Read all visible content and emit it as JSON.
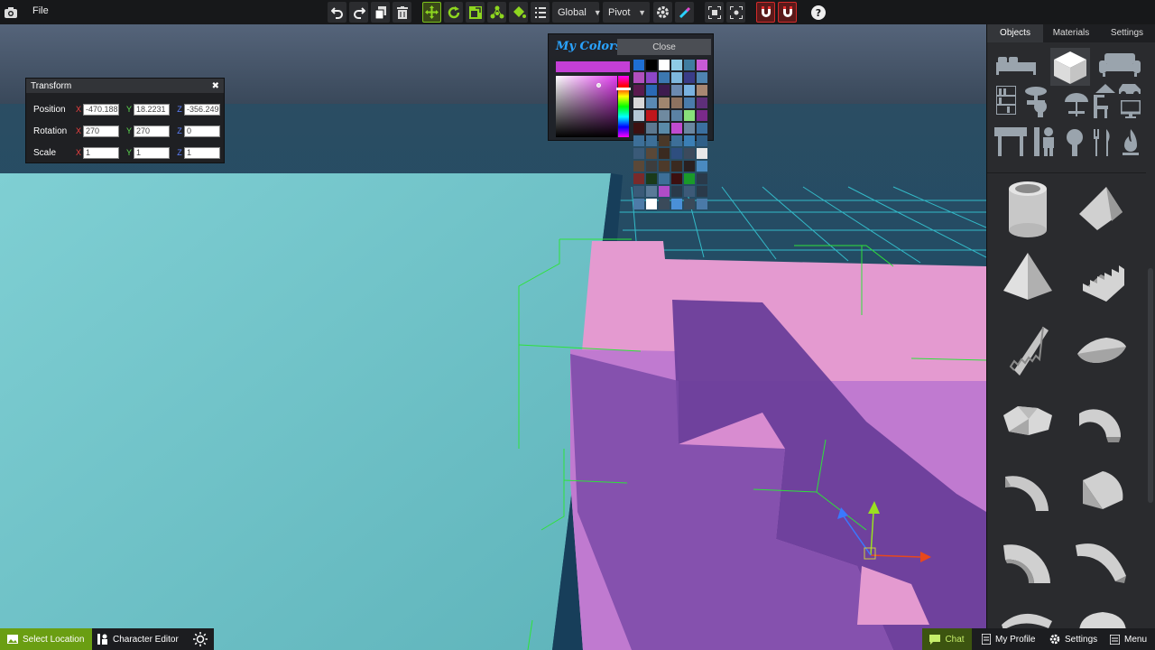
{
  "topbar": {
    "file_label": "File",
    "global_label": "Global",
    "pivot_label": "Pivot"
  },
  "transform": {
    "title": "Transform",
    "close_glyph": "✖",
    "rows": [
      {
        "label": "Position",
        "x": "-470.188",
        "y": "18.2231",
        "z": "-356.249"
      },
      {
        "label": "Rotation",
        "x": "270",
        "y": "270",
        "z": "0"
      },
      {
        "label": "Scale",
        "x": "1",
        "y": "1",
        "z": "1"
      }
    ],
    "axis_x": "X",
    "axis_y": "Y",
    "axis_z": "Z"
  },
  "colors": {
    "title": "My Colors",
    "close_label": "Close",
    "current_color": "#c43fd6",
    "swatches": [
      [
        "#1e6fd4",
        "#000000",
        "#ffffff",
        "#8ecbe6",
        "#3f7ca0",
        "#c85ad6"
      ],
      [
        "#b14fbd",
        "#8d47c7",
        "#3c78b0",
        "#7eb7dc",
        "#3a3c88",
        "#4f84b0"
      ],
      [
        "#5a1a4e",
        "#2a69b5",
        "#3d1b4e",
        "#6b8ab0",
        "#79b2e0",
        "#a88772"
      ],
      [
        "#d8d8d8",
        "#5a8ab4",
        "#a0866f",
        "#8d7260",
        "#4a7bab",
        "#5e2f7a"
      ],
      [
        "#b4c8d6",
        "#c0161c",
        "#6f8aa0",
        "#5b82a4",
        "#88e07a",
        "#7a2a8a"
      ],
      [
        "#3c1010",
        "#5c7890",
        "#5a8aa8",
        "#c04bd0",
        "#6a86a0",
        "#3b6f9f"
      ],
      [
        "#3d6f98",
        "#3d6f98",
        "#4a3828",
        "#3d6f98",
        "#3b7fb5",
        "#2f5f88"
      ],
      [
        "#3a5a78",
        "#5a4838",
        "#3a2a20",
        "#2e4e7f",
        "#3c4a5c",
        "#e8e8e8"
      ],
      [
        "#5a4838",
        "#3d3d3d",
        "#4d3a2a",
        "#3a2a20",
        "#2a2020",
        "#4a8ac0"
      ],
      [
        "#7a2a2a",
        "#1a3a1a",
        "#3d6f98",
        "#3c1010",
        "#1a9a2a",
        "#2a3a4a"
      ],
      [
        "#3a5a78",
        "#5a7a98",
        "#b04cc8",
        "#2a3a4a",
        "#3d5a78",
        "#2a3a4a"
      ],
      [
        "#4d7ba8",
        "#ffffff",
        "#3a4a5a",
        "#4a90d8",
        "#3a4a5a",
        "#4a7aa8"
      ]
    ]
  },
  "rpanel": {
    "tabs": [
      {
        "label": "Objects",
        "active": true
      },
      {
        "label": "Materials",
        "active": false
      },
      {
        "label": "Settings",
        "active": false
      }
    ]
  },
  "bottombar": {
    "select_location": "Select Location",
    "character_editor": "Character Editor",
    "chat": "Chat",
    "my_profile": "My Profile",
    "settings": "Settings",
    "menu": "Menu"
  },
  "scene": {
    "sky_top": "#394a5e",
    "sea": "#1f4f66",
    "grid_line": "#37d6e2",
    "floor": "#70c3c8",
    "pink": "#e49ad0",
    "shadow": "#6a3e9a",
    "outline_green": "#2ee23a",
    "gizmo_x": "#e8481c",
    "gizmo_y": "#9ae020",
    "gizmo_z": "#3a78ff"
  }
}
